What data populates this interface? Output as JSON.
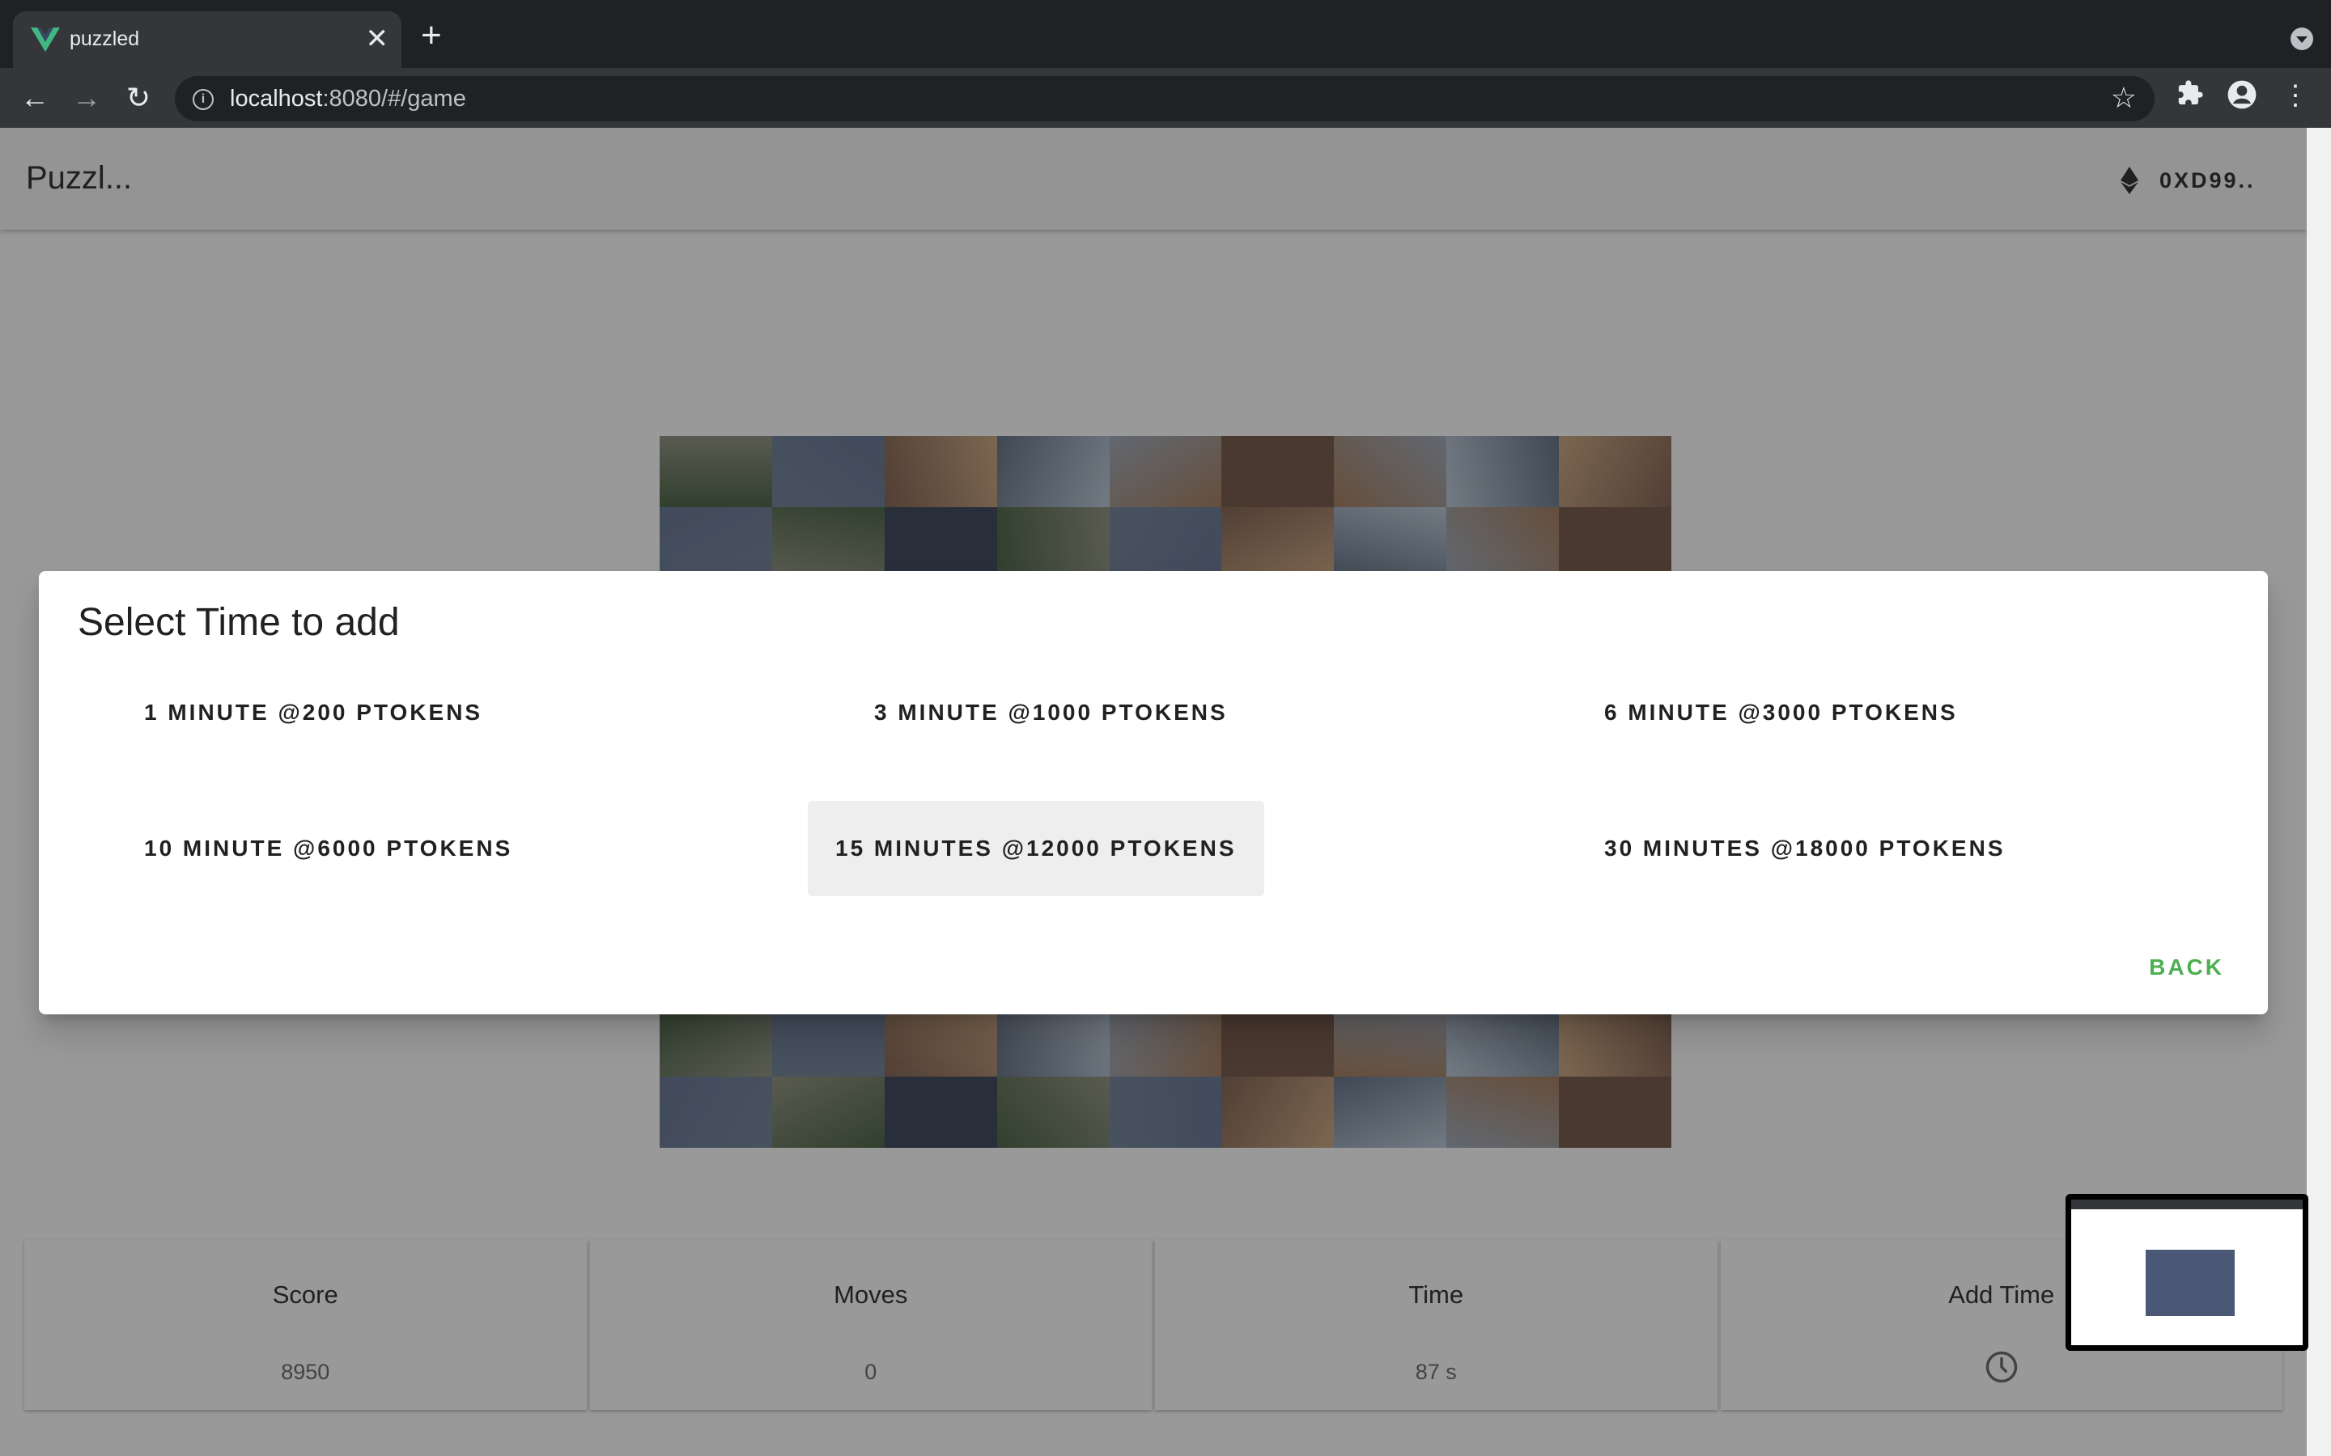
{
  "browser": {
    "tab_title": "puzzled",
    "url_host": "localhost",
    "url_rest": ":8080/#/game",
    "tab_close": "✕",
    "new_tab": "+"
  },
  "app": {
    "title": "Puzzl...",
    "wallet": "0XD99.."
  },
  "dialog": {
    "title": "Select Time to add",
    "options": [
      {
        "label": "1 MINUTE @200 PTOKENS"
      },
      {
        "label": "3 MINUTE @1000 PTOKENS"
      },
      {
        "label": "6 MINUTE @3000 PTOKENS"
      },
      {
        "label": "10 MINUTE @6000 PTOKENS"
      },
      {
        "label": "15 MINUTES @12000 PTOKENS"
      },
      {
        "label": "30 MINUTES @18000 PTOKENS"
      }
    ],
    "highlighted_option": "15 MINUTES @12000 PTOKENS",
    "back_label": "BACK"
  },
  "stats": {
    "score_label": "Score",
    "score_value": "8950",
    "moves_label": "Moves",
    "moves_value": "0",
    "time_label": "Time",
    "time_value": "87 s",
    "add_time_label": "Add Time"
  },
  "colors": {
    "accent": "#4caf50",
    "tile_palette": [
      "#5b6a7e",
      "#8a8c7a",
      "#6d4e3e",
      "#3f5a3a",
      "#b8c6d8",
      "#7b5a48",
      "#5f6f8e",
      "#9aa5b5",
      "#2f3b52",
      "#a07654",
      "#6a7c93",
      "#c9a27a"
    ]
  },
  "icons": {
    "back": "arrow-left-icon",
    "forward": "arrow-right-icon",
    "reload": "reload-icon",
    "info": "info-icon",
    "bookmark": "star-icon",
    "extensions": "puzzle-icon",
    "profile": "account-icon",
    "menu": "kebab-menu-icon",
    "eth": "ethereum-icon",
    "clock": "clock-icon"
  }
}
